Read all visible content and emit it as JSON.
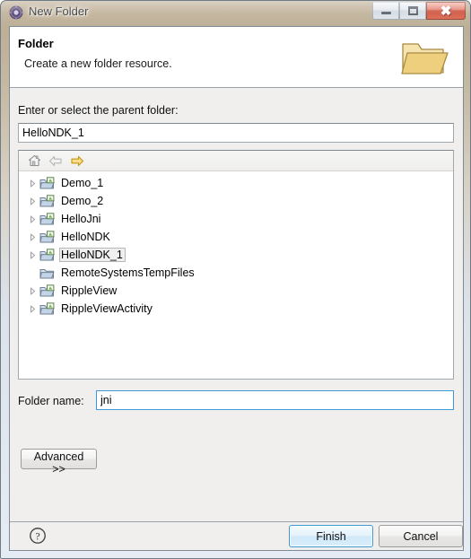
{
  "window": {
    "title": "New Folder",
    "icon": "eclipse-wizard-icon",
    "controls": {
      "minimize": "minimize-icon",
      "maximize": "maximize-icon",
      "close": "close-icon"
    }
  },
  "header": {
    "title": "Folder",
    "description": "Create a new folder resource.",
    "icon": "open-folder-icon"
  },
  "body": {
    "parent_label": "Enter or select the parent folder:",
    "parent_value": "HelloNDK_1",
    "folder_name_label": "Folder name:",
    "folder_name_value": "jni",
    "advanced_label": "Advanced >>"
  },
  "tree": {
    "toolbar": [
      {
        "name": "home-icon",
        "enabled": true
      },
      {
        "name": "back-arrow-icon",
        "enabled": false
      },
      {
        "name": "forward-arrow-icon",
        "enabled": true
      }
    ],
    "items": [
      {
        "label": "Demo_1",
        "icon": "project-folder-icon",
        "expandable": true,
        "selected": false
      },
      {
        "label": "Demo_2",
        "icon": "project-folder-icon",
        "expandable": true,
        "selected": false
      },
      {
        "label": "HelloJni",
        "icon": "project-folder-icon",
        "expandable": true,
        "selected": false
      },
      {
        "label": "HelloNDK",
        "icon": "project-folder-icon",
        "expandable": true,
        "selected": false
      },
      {
        "label": "HelloNDK_1",
        "icon": "project-folder-icon",
        "expandable": true,
        "selected": true
      },
      {
        "label": "RemoteSystemsTempFiles",
        "icon": "plain-folder-icon",
        "expandable": false,
        "selected": false
      },
      {
        "label": "RippleView",
        "icon": "project-folder-icon",
        "expandable": true,
        "selected": false
      },
      {
        "label": "RippleViewActivity",
        "icon": "project-folder-icon",
        "expandable": true,
        "selected": false
      }
    ]
  },
  "footer": {
    "help_icon": "help-question-icon",
    "finish_label": "Finish",
    "cancel_label": "Cancel"
  },
  "colors": {
    "accent": "#3c9ad6",
    "folder_yellow": "#e8c96a",
    "close_red": "#c63d26",
    "arrow_orange": "#e8a317"
  }
}
